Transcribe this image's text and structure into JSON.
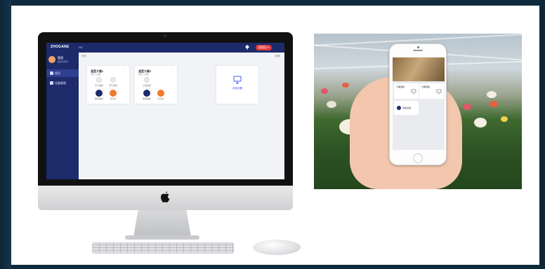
{
  "app": {
    "logo": "ZHOGANE",
    "topnav": "HZ",
    "user_badge": "管理员 ▾",
    "profile_name": "管理",
    "profile_sub": "超级管理员",
    "breadcrumb": "首页",
    "toolbar_right": "刷新"
  },
  "sidebar": {
    "items": [
      {
        "label": "首页"
      },
      {
        "label": "设备管理"
      }
    ]
  },
  "devices": [
    {
      "title": "温室大棚1",
      "sub": "在线 | 设备",
      "sensors": [
        "空气温度",
        "空气湿度"
      ],
      "controls": [
        "卷帘电机",
        "补光灯"
      ]
    },
    {
      "title": "温室大棚2",
      "sub": "在线 | 设备",
      "sensors": [
        "土壤温度"
      ],
      "controls": [
        "卷帘电机",
        "补光灯"
      ]
    }
  ],
  "add_card": {
    "label": "添加设备"
  },
  "phone": {
    "card1": "大棚温度",
    "card2": "大棚湿度",
    "card3": "添加设备"
  },
  "colors": {
    "brand": "#1d2b6b",
    "accent_orange": "#f07a2a",
    "badge_red": "#e23b3b"
  },
  "icons": {
    "apple": "apple-icon",
    "add": "add-device-icon",
    "pin": "pin-icon"
  }
}
